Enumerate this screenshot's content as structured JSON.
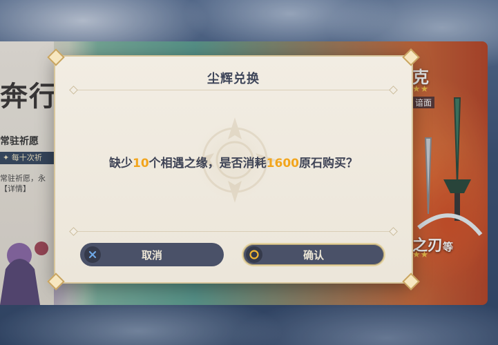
{
  "background_banner": {
    "title": "奔行",
    "subtitle": "常驻祈愿",
    "strip_text": "✦ 每十次祈",
    "line1": "常驻祈愿，永",
    "line2": "【详情】",
    "right_character_name": "克",
    "right_tag": "谙面",
    "weapon_name": "之刃",
    "weapon_suffix": "等",
    "stars": "★★"
  },
  "dialog": {
    "title": "尘辉兑换",
    "message": {
      "part1": "缺少",
      "count": "10",
      "part2": "个相遇之缘，是否消耗",
      "cost": "1600",
      "part3": "原石购买？"
    },
    "buttons": {
      "cancel_label": "取消",
      "cancel_icon": "x-circle-icon",
      "confirm_label": "确认",
      "confirm_icon": "o-circle-icon"
    },
    "accent_color": "#f2a51c"
  }
}
